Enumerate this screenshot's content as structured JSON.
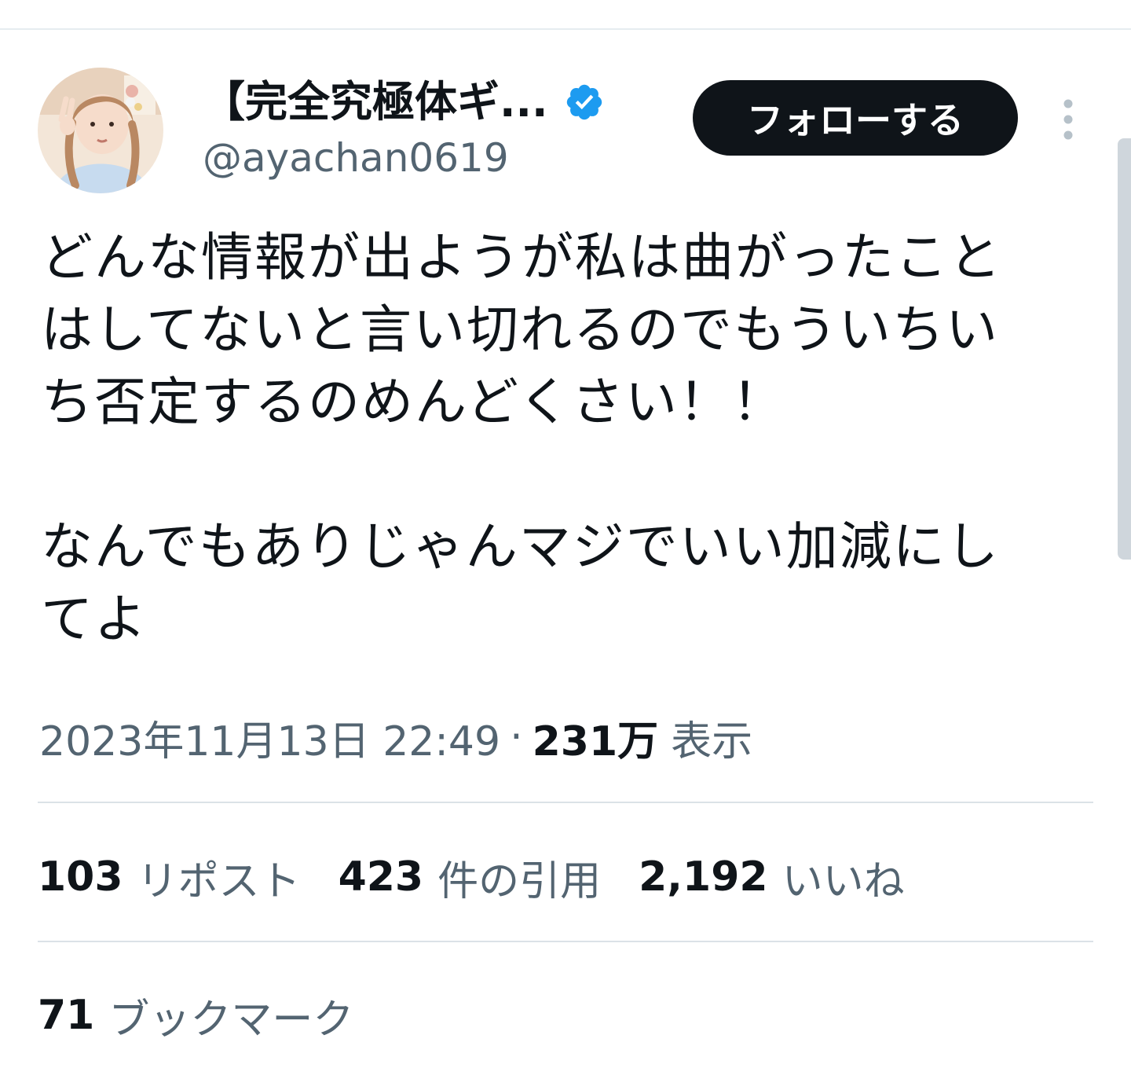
{
  "author": {
    "display_name": "【完全究極体ギ...",
    "handle": "@ayachan0619",
    "verified": true,
    "avatar_icon": "profile-photo"
  },
  "header": {
    "follow_label": "フォローする",
    "more_icon": "vertical-ellipsis-icon"
  },
  "tweet": {
    "line1": "どんな情報が出ようが私は曲がったこと",
    "line2": "はしてないと言い切れるのでもういちい",
    "line3": "ち否定するのめんどくさい！！",
    "line4": "なんでもありじゃんマジでいい加減にし",
    "line5": "てよ"
  },
  "meta": {
    "timestamp": "2023年11月13日 22:49",
    "separator": "·",
    "views_count": "231万",
    "views_label": "表示"
  },
  "stats": {
    "reposts_count": "103",
    "reposts_label": "リポスト",
    "quotes_count": "423",
    "quotes_label": "件の引用",
    "likes_count": "2,192",
    "likes_label": "いいね",
    "bookmarks_count": "71",
    "bookmarks_label": "ブックマーク"
  },
  "colors": {
    "text_primary": "#0f1419",
    "text_secondary": "#536471",
    "verified_blue": "#1d9bf0",
    "divider": "#dbe2e7",
    "button_bg": "#0f1419"
  }
}
